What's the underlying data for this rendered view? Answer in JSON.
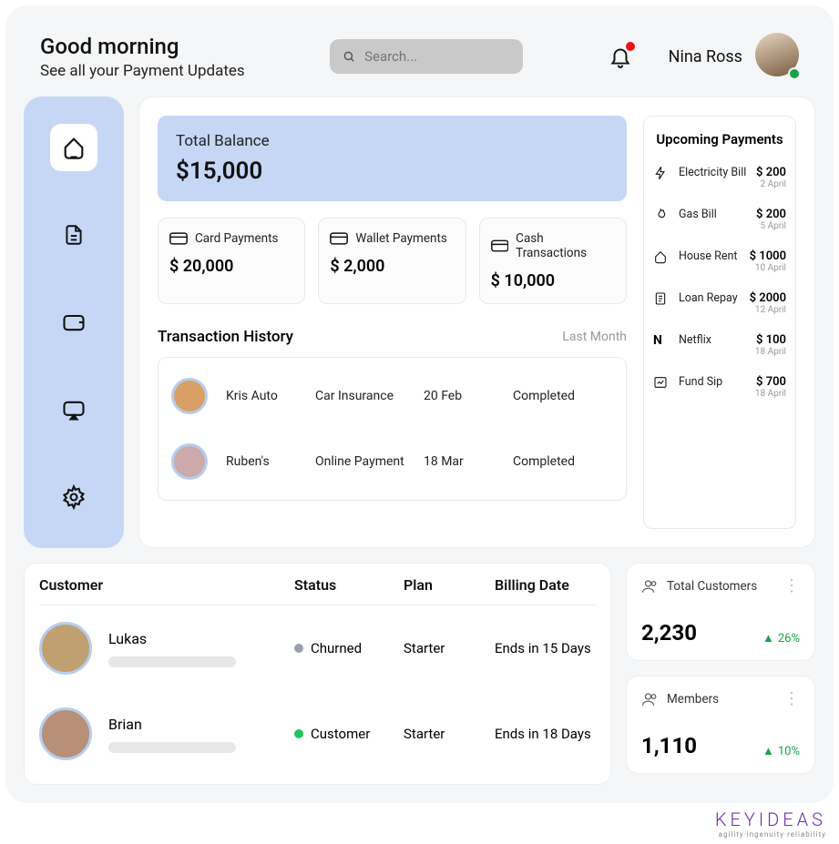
{
  "header": {
    "greeting": "Good morning",
    "subtitle": "See all your Payment Updates",
    "search_placeholder": "Search...",
    "user_name": "Nina Ross"
  },
  "balance": {
    "label": "Total Balance",
    "amount": "$15,000"
  },
  "pay_cards": [
    {
      "label": "Card Payments",
      "amount": "$ 20,000"
    },
    {
      "label": "Wallet Payments",
      "amount": "$ 2,000"
    },
    {
      "label": "Cash Transactions",
      "amount": "$ 10,000"
    }
  ],
  "history": {
    "title": "Transaction History",
    "filter": "Last Month",
    "rows": [
      {
        "name": "Kris Auto",
        "type": "Car Insurance",
        "date": "20 Feb",
        "status": "Completed"
      },
      {
        "name": "Ruben's",
        "type": "Online Payment",
        "date": "18 Mar",
        "status": "Completed"
      }
    ]
  },
  "upcoming": {
    "title": "Upcoming Payments",
    "items": [
      {
        "name": "Electricity Bill",
        "amount": "$ 200",
        "date": "2 April",
        "icon": "bolt"
      },
      {
        "name": "Gas Bill",
        "amount": "$ 200",
        "date": "5 April",
        "icon": "flame"
      },
      {
        "name": "House Rent",
        "amount": "$ 1000",
        "date": "10 April",
        "icon": "home"
      },
      {
        "name": "Loan Repay",
        "amount": "$ 2000",
        "date": "12 April",
        "icon": "doc"
      },
      {
        "name": "Netflix",
        "amount": "$ 100",
        "date": "18 April",
        "icon": "n"
      },
      {
        "name": "Fund Sip",
        "amount": "$ 700",
        "date": "18 April",
        "icon": "chart"
      }
    ]
  },
  "customers": {
    "cols": {
      "c1": "Customer",
      "c2": "Status",
      "c3": "Plan",
      "c4": "Billing Date"
    },
    "rows": [
      {
        "name": "Lukas",
        "status": "Churned",
        "dot": "#9aa1a9",
        "plan": "Starter",
        "billing": "Ends in 15 Days"
      },
      {
        "name": "Brian",
        "status": "Customer",
        "dot": "#22c55e",
        "plan": "Starter",
        "billing": "Ends in 18 Days"
      }
    ]
  },
  "stats": [
    {
      "label": "Total Customers",
      "value": "2,230",
      "trend": "26%"
    },
    {
      "label": "Members",
      "value": "1,110",
      "trend": "10%"
    }
  ],
  "brand": {
    "name": "KEYIDEAS",
    "tag": "agility·ingenuity·reliability"
  }
}
